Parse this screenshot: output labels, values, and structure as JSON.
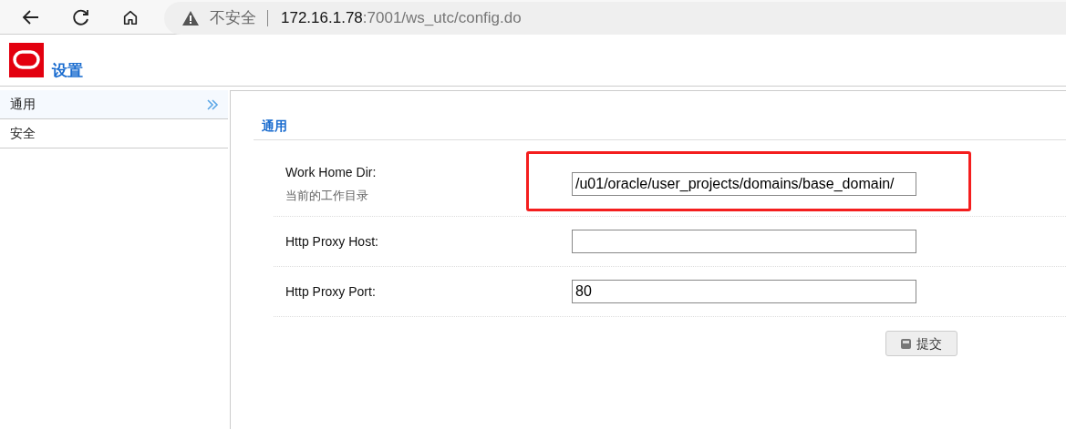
{
  "browser": {
    "security": "不安全",
    "url_host": "172.16.1.78",
    "url_path": ":7001/ws_utc/config.do"
  },
  "header": {
    "title": "设置"
  },
  "sidebar": {
    "items": [
      {
        "label": "通用",
        "selected": true
      },
      {
        "label": "安全",
        "selected": false
      }
    ]
  },
  "section": {
    "title": "通用"
  },
  "fields": [
    {
      "label": "Work Home Dir:",
      "hint": "当前的工作目录",
      "value": "/u01/oracle/user_projects/domains/base_domain/",
      "highlighted": true
    },
    {
      "label": "Http Proxy Host:",
      "highlighted": false
    },
    {
      "label": "Http Proxy Port:",
      "value": "80",
      "highlighted": false
    }
  ],
  "submit": {
    "label": "提交"
  }
}
